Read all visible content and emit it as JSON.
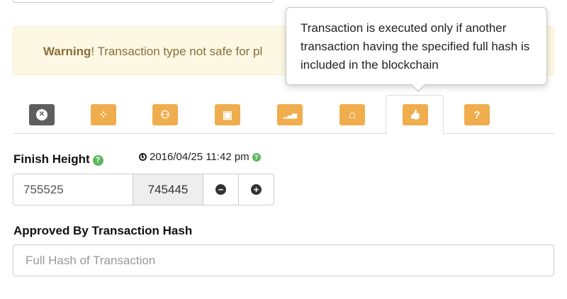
{
  "warning": {
    "strong": "Warning",
    "text": "! Transaction type not safe for pl"
  },
  "tooltip": {
    "text": "Transaction is executed only if another transaction having the specified full hash is included in the blockchain"
  },
  "tabs": [
    {
      "icon": "close-circle-icon",
      "glyph": "✕",
      "color": "#5e5e5e"
    },
    {
      "icon": "spinner-icon",
      "glyph": "⁘",
      "color": "#f0ad4e"
    },
    {
      "icon": "users-icon",
      "glyph": "⚇",
      "color": "#f0ad4e"
    },
    {
      "icon": "money-icon",
      "glyph": "▣",
      "color": "#f0ad4e"
    },
    {
      "icon": "signal-icon",
      "glyph": "▁▃▅",
      "color": "#f0ad4e"
    },
    {
      "icon": "bank-icon",
      "glyph": "⌂",
      "color": "#f0ad4e"
    },
    {
      "icon": "thumbs-up-icon",
      "glyph": "👍",
      "color": "#f0ad4e",
      "active": true
    },
    {
      "icon": "question-icon",
      "glyph": "?",
      "color": "#f0ad4e"
    }
  ],
  "finish_height": {
    "label": "Finish Height",
    "date": "2016/04/25 11:42 pm",
    "value": "755525",
    "current": "745445"
  },
  "approved_hash": {
    "label": "Approved By Transaction Hash",
    "placeholder": "Full Hash of Transaction"
  }
}
